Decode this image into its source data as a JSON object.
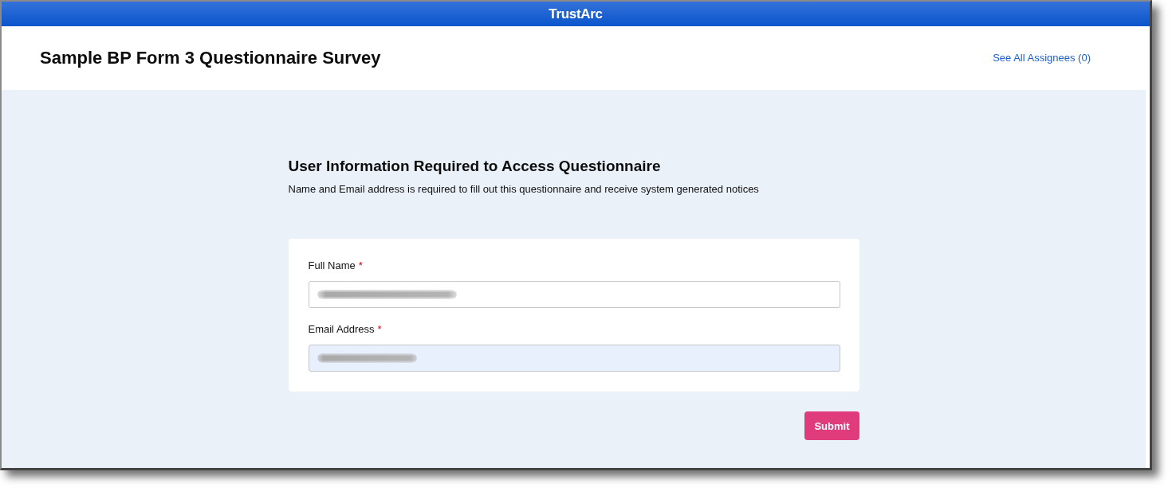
{
  "top_bar": {
    "brand": "TrustArc"
  },
  "header": {
    "title": "Sample BP Form 3 Questionnaire Survey",
    "assignees_link": "See All Assignees (0)"
  },
  "form": {
    "heading": "User Information Required to Access Questionnaire",
    "description": "Name and Email address is required to fill out this questionnaire and receive system generated notices",
    "fields": [
      {
        "label": "Full Name",
        "required_mark": "*",
        "autofilled": false,
        "value_blurred": true
      },
      {
        "label": "Email Address",
        "required_mark": "*",
        "autofilled": true,
        "value_blurred": true
      }
    ],
    "submit_button": "Submit"
  }
}
